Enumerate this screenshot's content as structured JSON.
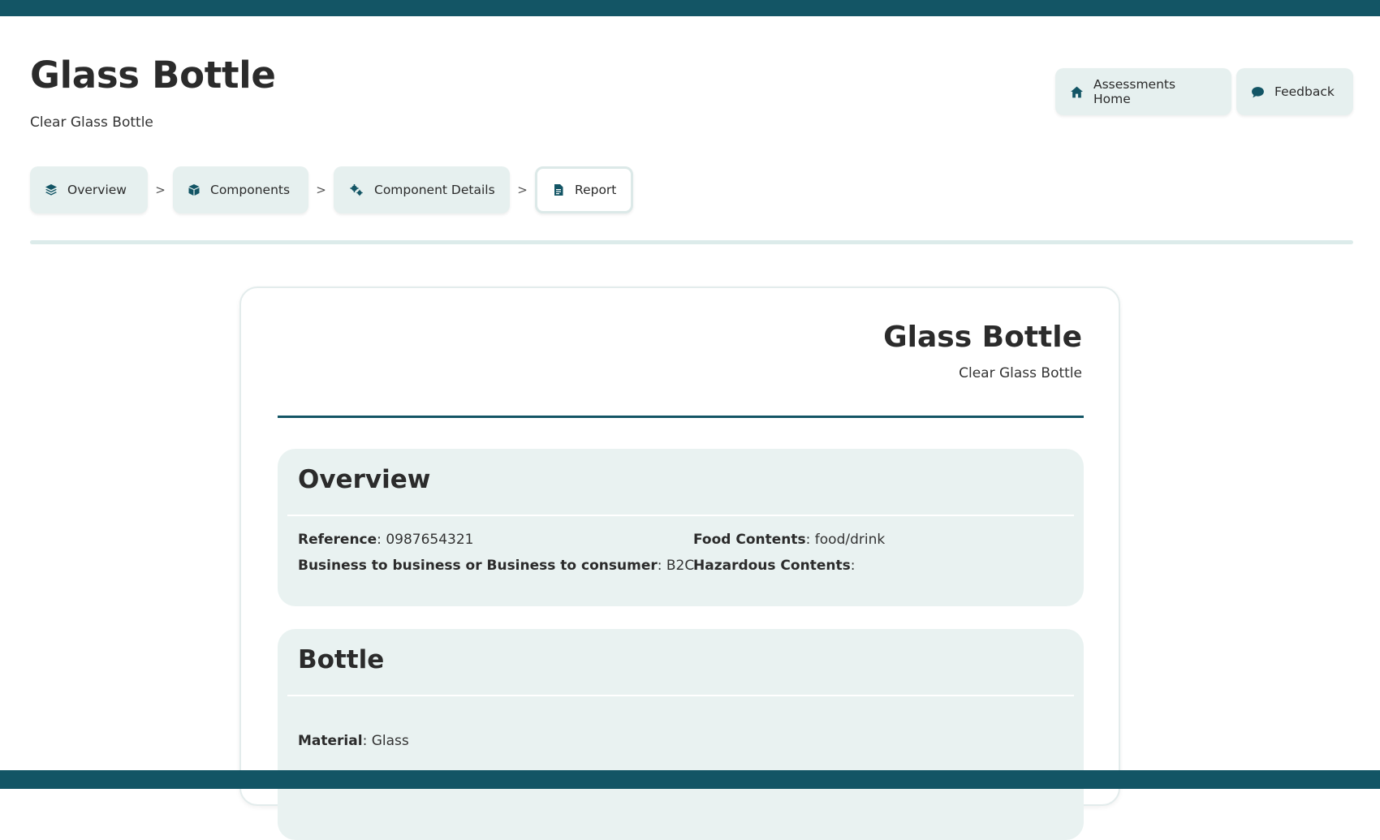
{
  "header": {
    "title": "Glass Bottle",
    "subtitle": "Clear Glass Bottle"
  },
  "actions": {
    "home_label": "Assessments Home",
    "feedback_label": "Feedback"
  },
  "steps": [
    {
      "label": "Overview",
      "icon": "layers-icon"
    },
    {
      "label": "Components",
      "icon": "box-icon"
    },
    {
      "label": "Component Details",
      "icon": "gears-icon"
    },
    {
      "label": "Report",
      "icon": "file-icon",
      "active": true
    }
  ],
  "step_separator": ">",
  "report": {
    "title": "Glass Bottle",
    "subtitle": "Clear Glass Bottle",
    "overview": {
      "heading": "Overview",
      "reference_label": "Reference",
      "reference_value": "0987654321",
      "b2b_label": "Business to business or Business to consumer",
      "b2b_value": "B2C",
      "food_label": "Food Contents",
      "food_value": "food/drink",
      "hazardous_label": "Hazardous Contents",
      "hazardous_value": ""
    },
    "bottle": {
      "heading": "Bottle",
      "material_label": "Material",
      "material_value": "Glass"
    }
  },
  "colors": {
    "brand": "#135565",
    "tile_bg": "#e6f0ef",
    "section_bg": "#e9f2f1"
  }
}
